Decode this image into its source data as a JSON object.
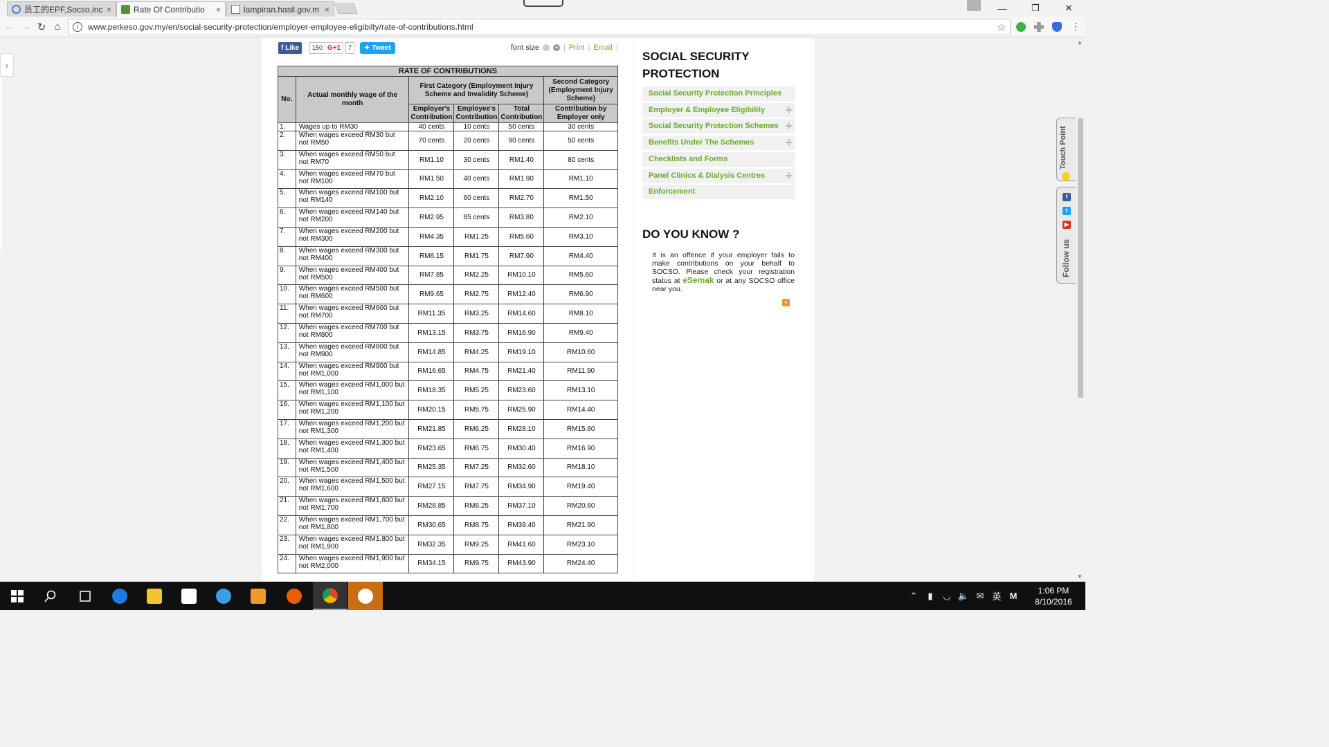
{
  "browser": {
    "tabs": [
      {
        "title": "员工的EPF,Socso,ince",
        "active": false
      },
      {
        "title": "Rate Of Contributio",
        "active": true
      },
      {
        "title": "lampiran.hasil.gov.m",
        "active": false
      }
    ],
    "close_glyph": "×",
    "url": "www.perkeso.gov.my/en/social-security-protection/employer-employee-eligibilty/rate-of-contributions.html"
  },
  "share": {
    "fb_like": "Like",
    "fb_count": "150",
    "gplus": "G+1",
    "gplus_count": "7",
    "tweet": "Tweet",
    "font_size_label": "font size",
    "print": "Print",
    "email": "Email"
  },
  "table": {
    "caption": "RATE OF CONTRIBUTIONS",
    "headers": {
      "no": "No.",
      "wage": "Actual monthly wage of the month",
      "first_category": "First Category (Employment Injury Scheme and Invalidity Scheme)",
      "second_category": "Second Category (Employment Injury Scheme)",
      "employer": "Employer's Contribution",
      "employee": "Employee's Contribution",
      "total": "Total Contribution",
      "employer_only": "Contribution by Employer only"
    },
    "rows": [
      {
        "no": "1.",
        "desc": "Wages up to RM30",
        "er": "40 cents",
        "ee": "10 cents",
        "total": "50 cents",
        "er_only": "30 cents"
      },
      {
        "no": "2.",
        "desc": "When wages exceed RM30 but not RM50",
        "er": "70 cents",
        "ee": "20 cents",
        "total": "90 cents",
        "er_only": "50 cents"
      },
      {
        "no": "3.",
        "desc": "When wages exceed RM50 but not RM70",
        "er": "RM1.10",
        "ee": "30 cents",
        "total": "RM1.40",
        "er_only": "80 cents"
      },
      {
        "no": "4.",
        "desc": "When wages exceed RM70 but not RM100",
        "er": "RM1.50",
        "ee": "40 cents",
        "total": "RM1.90",
        "er_only": "RM1.10"
      },
      {
        "no": "5.",
        "desc": "When wages exceed RM100 but not RM140",
        "er": "RM2.10",
        "ee": "60 cents",
        "total": "RM2.70",
        "er_only": "RM1.50"
      },
      {
        "no": "6.",
        "desc": "When wages exceed RM140 but not RM200",
        "er": "RM2.95",
        "ee": "85 cents",
        "total": "RM3.80",
        "er_only": "RM2.10"
      },
      {
        "no": "7.",
        "desc": "When wages exceed RM200 but not RM300",
        "er": "RM4.35",
        "ee": "RM1.25",
        "total": "RM5.60",
        "er_only": "RM3.10"
      },
      {
        "no": "8.",
        "desc": "When wages exceed RM300 but not RM400",
        "er": "RM6.15",
        "ee": "RM1.75",
        "total": "RM7.90",
        "er_only": "RM4.40"
      },
      {
        "no": "9.",
        "desc": "When wages exceed RM400 but not RM500",
        "er": "RM7.85",
        "ee": "RM2.25",
        "total": "RM10.10",
        "er_only": "RM5.60"
      },
      {
        "no": "10.",
        "desc": "When wages exceed RM500 but not RM600",
        "er": "RM9.65",
        "ee": "RM2.75",
        "total": "RM12.40",
        "er_only": "RM6.90"
      },
      {
        "no": "11.",
        "desc": "When wages exceed RM600 but not RM700",
        "er": "RM11.35",
        "ee": "RM3.25",
        "total": "RM14.60",
        "er_only": "RM8.10"
      },
      {
        "no": "12.",
        "desc": "When wages exceed RM700 but not RM800",
        "er": "RM13.15",
        "ee": "RM3.75",
        "total": "RM16.90",
        "er_only": "RM9.40"
      },
      {
        "no": "13.",
        "desc": "When wages exceed RM800 but not RM900",
        "er": "RM14.85",
        "ee": "RM4.25",
        "total": "RM19.10",
        "er_only": "RM10.60"
      },
      {
        "no": "14.",
        "desc": "When wages exceed RM900 but not RM1,000",
        "er": "RM16.65",
        "ee": "RM4.75",
        "total": "RM21.40",
        "er_only": "RM11.90"
      },
      {
        "no": "15.",
        "desc": "When wages exceed RM1,000 but not RM1,100",
        "er": "RM18.35",
        "ee": "RM5.25",
        "total": "RM23.60",
        "er_only": "RM13.10"
      },
      {
        "no": "16.",
        "desc": "When wages exceed RM1,100 but not RM1,200",
        "er": "RM20.15",
        "ee": "RM5.75",
        "total": "RM25.90",
        "er_only": "RM14.40"
      },
      {
        "no": "17.",
        "desc": "When wages exceed RM1,200 but not RM1,300",
        "er": "RM21.85",
        "ee": "RM6.25",
        "total": "RM28.10",
        "er_only": "RM15.60"
      },
      {
        "no": "18.",
        "desc": "When wages exceed RM1,300 but not RM1,400",
        "er": "RM23.65",
        "ee": "RM6.75",
        "total": "RM30.40",
        "er_only": "RM16.90"
      },
      {
        "no": "19.",
        "desc": "When wages exceed RM1,400 but not RM1,500",
        "er": "RM25.35",
        "ee": "RM7.25",
        "total": "RM32.60",
        "er_only": "RM18.10"
      },
      {
        "no": "20.",
        "desc": "When wages exceed RM1,500 but not RM1,600",
        "er": "RM27.15",
        "ee": "RM7.75",
        "total": "RM34.90",
        "er_only": "RM19.40"
      },
      {
        "no": "21.",
        "desc": "When wages exceed RM1,600 but not RM1,700",
        "er": "RM28.85",
        "ee": "RM8.25",
        "total": "RM37.10",
        "er_only": "RM20.60"
      },
      {
        "no": "22.",
        "desc": "When wages exceed RM1,700 but not RM1,800",
        "er": "RM30.65",
        "ee": "RM8.75",
        "total": "RM39.40",
        "er_only": "RM21.90"
      },
      {
        "no": "23.",
        "desc": "When wages exceed RM1,800 but not RM1,900",
        "er": "RM32.35",
        "ee": "RM9.25",
        "total": "RM41.60",
        "er_only": "RM23.10"
      },
      {
        "no": "24.",
        "desc": "When wages exceed RM1,900 but not RM2,000",
        "er": "RM34.15",
        "ee": "RM9.75",
        "total": "RM43.90",
        "er_only": "RM24.40"
      }
    ]
  },
  "sidebar": {
    "title": "SOCIAL SECURITY PROTECTION",
    "menu": [
      {
        "label": "Social Security Protection Principles",
        "expandable": false
      },
      {
        "label": "Employer & Employee Eligibility",
        "expandable": true
      },
      {
        "label": "Social Security Protection Schemes",
        "expandable": true
      },
      {
        "label": "Benefits Under The Schemes",
        "expandable": true
      },
      {
        "label": "Checklists and Forms",
        "expandable": false
      },
      {
        "label": "Panel Clinics & Dialysis Centres",
        "expandable": true
      },
      {
        "label": "Enforcement",
        "expandable": false
      }
    ],
    "plus_glyph": "+",
    "dyk_title": "DO YOU KNOW ?",
    "dyk_text": "It is an offence if your employer fails to make contributions on your behalf to SOCSO. Please check your registration status at",
    "dyk_link": "eSemak",
    "dyk_tail": "or at any SOCSO office near you."
  },
  "widgets": {
    "touch_point": "Touch Point",
    "follow_us": "Follow us"
  },
  "taskbar": {
    "ime": "英",
    "time": "1:06 PM",
    "date": "8/10/2016"
  }
}
